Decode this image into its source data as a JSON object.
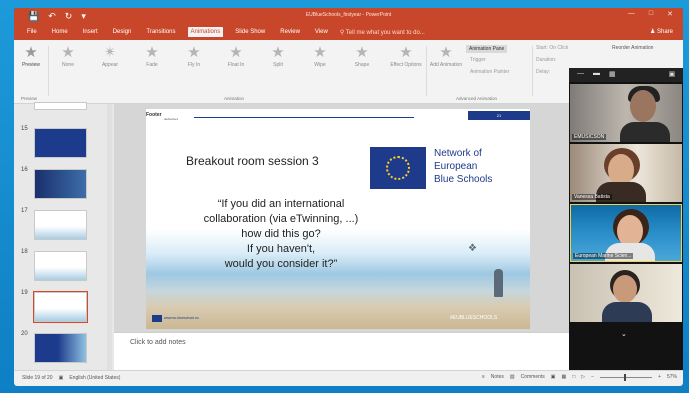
{
  "window": {
    "title": "EUBlueSchools_firstyear - PowerPoint",
    "share_label": "Share",
    "qat_icons": [
      "save-icon",
      "undo-icon",
      "redo-icon",
      "customize-icon"
    ]
  },
  "ribbon_tabs": [
    {
      "label": "File"
    },
    {
      "label": "Home"
    },
    {
      "label": "Insert"
    },
    {
      "label": "Design"
    },
    {
      "label": "Transitions"
    },
    {
      "label": "Animations",
      "active": true
    },
    {
      "label": "Slide Show"
    },
    {
      "label": "Review"
    },
    {
      "label": "View"
    }
  ],
  "tell_me": "Tell me what you want to do...",
  "ribbon": {
    "preview_label": "Preview",
    "preview_group": "Preview",
    "animations": [
      "None",
      "Appear",
      "Fade",
      "Fly In",
      "Float In",
      "Split",
      "Wipe",
      "Shape"
    ],
    "animation_group": "Animation",
    "effect_options": "Effect Options",
    "add_animation": "Add Animation",
    "animation_pane": "Animation Pane",
    "trigger": "Trigger",
    "animation_painter": "Animation Painter",
    "advanced_group": "Advanced Animation",
    "start": "Start: On Click",
    "duration": "Duration:",
    "delay": "Delay:",
    "reorder": "Reorder Animation"
  },
  "thumbnails": [
    {
      "num": "15"
    },
    {
      "num": "16"
    },
    {
      "num": "17"
    },
    {
      "num": "18"
    },
    {
      "num": "19",
      "selected": true
    },
    {
      "num": "20"
    }
  ],
  "slide": {
    "footer_label": "Footer",
    "footer_sub": "dedrecters",
    "slide_number": "21",
    "title": "Breakout room session 3",
    "network_line1": "Network of",
    "network_line2": "European",
    "network_line3": "Blue Schools",
    "quote_line1": "“If you did an international",
    "quote_line2": "collaboration (via eTwinning, ...)",
    "quote_line3": "how did this go?",
    "quote_line4": "If you haven't,",
    "quote_line5": "would you consider it?”",
    "eu_text": "www.eu-blueschool.eu",
    "hashtag": "#EUBLUESCHOOLS"
  },
  "notes_placeholder": "Click to add notes",
  "participants": [
    {
      "name": "EMUSICSON"
    },
    {
      "name": "Vanessa Batista"
    },
    {
      "name": "European Marine Scien..."
    },
    {
      "name": ""
    }
  ],
  "status": {
    "slide_of": "Slide 19 of 20",
    "language": "English (United States)",
    "notes": "Notes",
    "comments": "Comments",
    "zoom": "57%"
  },
  "colors": {
    "accent": "#c8472a",
    "eu_blue": "#1e3a8a",
    "desktop": "#1d9ad9"
  }
}
